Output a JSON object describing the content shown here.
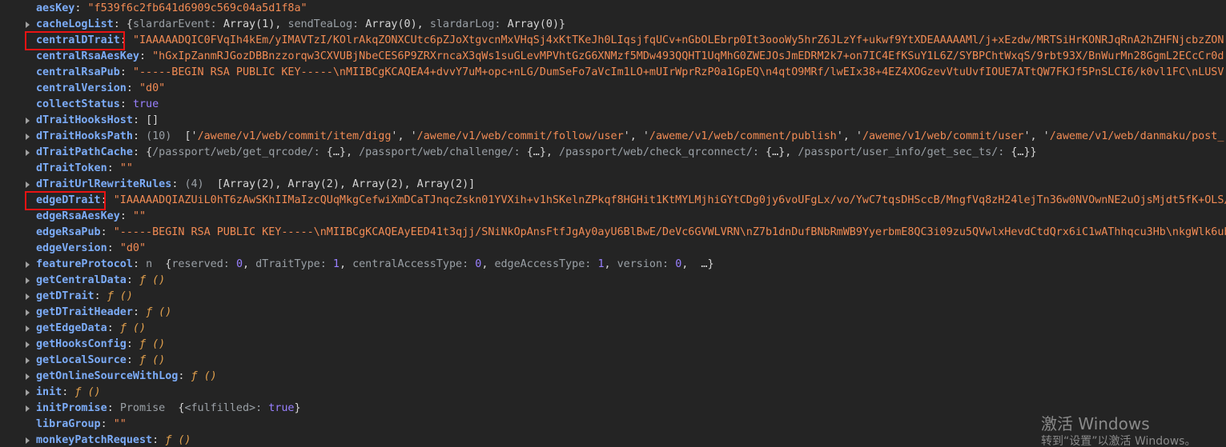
{
  "rows": [
    {
      "key": "aesKey",
      "expandable": false,
      "segments": [
        {
          "t": "str",
          "v": "\"f539f6c2fb641d6909c569c04a5d1f8a\""
        }
      ]
    },
    {
      "key": "cacheLogList",
      "expandable": true,
      "segments": [
        {
          "t": "plain",
          "v": "{"
        },
        {
          "t": "dim",
          "v": "slardarEvent: "
        },
        {
          "t": "plain",
          "v": "Array(1), "
        },
        {
          "t": "dim",
          "v": "sendTeaLog: "
        },
        {
          "t": "plain",
          "v": "Array(0), "
        },
        {
          "t": "dim",
          "v": "slardarLog: "
        },
        {
          "t": "plain",
          "v": "Array(0)}"
        }
      ]
    },
    {
      "key": "centralDTrait",
      "expandable": false,
      "highlighted": true,
      "segments": [
        {
          "t": "str",
          "v": "\"IAAAAADQIC0FVqIh4kEm/yIMAVTzI/KOlrAkqZONXCUtc6pZJoXtgvcnMxVHqSj4xKtTKeJh0LIqsjfqUCv+nGbOLEbrp0It3oooWy5hrZ6JLzYf+ukwf9YtXDEAAAAAMl/j+xEzdw/MRTSiHrKONRJqRnA2hZHFNjcbzZON"
        }
      ]
    },
    {
      "key": "centralRsaAesKey",
      "expandable": false,
      "segments": [
        {
          "t": "str",
          "v": "\"hGxIpZanmRJGozDBBnzzorqw3CXVUBjNbeCES6P9ZRXrncaX3qWs1suGLevMPVhtGzG6XNMzf5MDw493QQHT1UqMhG0ZWEJOsJmEDRM2k7+on7IC4EfKSuY1L6Z/SYBPChtWxqS/9rbt93X/BnWurMn28GgmL2ECcCr0d"
        }
      ]
    },
    {
      "key": "centralRsaPub",
      "expandable": false,
      "segments": [
        {
          "t": "str",
          "v": "\"-----BEGIN RSA PUBLIC KEY-----\\nMIIBCgKCAQEA4+dvvY7uM+opc+nLG/DumSeFo7aVcIm1LO+mUIrWprRzP0a1GpEQ\\n4qtO9MRf/lwEIx38+4EZ4XOGzevVtuUvfIOUE7ATtQW7FKJf5PnSLCI6/k0vl1FC\\nLUSV"
        }
      ]
    },
    {
      "key": "centralVersion",
      "expandable": false,
      "segments": [
        {
          "t": "str",
          "v": "\"d0\""
        }
      ]
    },
    {
      "key": "collectStatus",
      "expandable": false,
      "segments": [
        {
          "t": "bool",
          "v": "true"
        }
      ]
    },
    {
      "key": "dTraitHooksHost",
      "expandable": true,
      "segments": [
        {
          "t": "plain",
          "v": "[]"
        }
      ]
    },
    {
      "key": "dTraitHooksPath",
      "expandable": true,
      "segments": [
        {
          "t": "dim",
          "v": "(10)  "
        },
        {
          "t": "plain",
          "v": "['"
        },
        {
          "t": "str",
          "v": "/aweme/v1/web/commit/item/digg"
        },
        {
          "t": "plain",
          "v": "', '"
        },
        {
          "t": "str",
          "v": "/aweme/v1/web/commit/follow/user"
        },
        {
          "t": "plain",
          "v": "', '"
        },
        {
          "t": "str",
          "v": "/aweme/v1/web/comment/publish"
        },
        {
          "t": "plain",
          "v": "', '"
        },
        {
          "t": "str",
          "v": "/aweme/v1/web/commit/user"
        },
        {
          "t": "plain",
          "v": "', '"
        },
        {
          "t": "str",
          "v": "/aweme/v1/web/danmaku/post_"
        }
      ]
    },
    {
      "key": "dTraitPathCache",
      "expandable": true,
      "segments": [
        {
          "t": "plain",
          "v": "{"
        },
        {
          "t": "dim",
          "v": "/passport/web/get_qrcode/: "
        },
        {
          "t": "plain",
          "v": "{…}, "
        },
        {
          "t": "dim",
          "v": "/passport/web/challenge/: "
        },
        {
          "t": "plain",
          "v": "{…}, "
        },
        {
          "t": "dim",
          "v": "/passport/web/check_qrconnect/: "
        },
        {
          "t": "plain",
          "v": "{…}, "
        },
        {
          "t": "dim",
          "v": "/passport/user_info/get_sec_ts/: "
        },
        {
          "t": "plain",
          "v": "{…}}"
        }
      ]
    },
    {
      "key": "dTraitToken",
      "expandable": false,
      "segments": [
        {
          "t": "str",
          "v": "\"\""
        }
      ]
    },
    {
      "key": "dTraitUrlRewriteRules",
      "expandable": true,
      "segments": [
        {
          "t": "dim",
          "v": "(4)  "
        },
        {
          "t": "plain",
          "v": "[Array(2), Array(2), Array(2), Array(2)]"
        }
      ]
    },
    {
      "key": "edgeDTrait",
      "expandable": false,
      "highlighted": true,
      "segments": [
        {
          "t": "str",
          "v": "\"IAAAAADQIAZUiL0hT6zAwSKhIIMaIzcQUqMkgCefwiXmDCaTJnqcZskn01YVXih+v1hSKelnZPkqf8HGHit1KtMYLMjhiGYtCDg0jy6voUFgLx/vo/YwC7tqsDHSccB/MngfVq8zH24lejTn36w0NVOwnNE2uOjsMjdt5fK+OLS/"
        }
      ]
    },
    {
      "key": "edgeRsaAesKey",
      "expandable": false,
      "segments": [
        {
          "t": "str",
          "v": "\"\""
        }
      ]
    },
    {
      "key": "edgeRsaPub",
      "expandable": false,
      "segments": [
        {
          "t": "str",
          "v": "\"-----BEGIN RSA PUBLIC KEY-----\\nMIIBCgKCAQEAyEED41t3qjj/SNiNkOpAnsFtfJgAy0ayU6BlBwE/DeVc6GVWLVRN\\nZ7b1dnDufBNbRmWB9YyerbmE8QC3i09zu5QVwlxHevdCtdQrx6iC1wAThhqcu3Hb\\nkgWlk6ub"
        }
      ]
    },
    {
      "key": "edgeVersion",
      "expandable": false,
      "segments": [
        {
          "t": "str",
          "v": "\"d0\""
        }
      ]
    },
    {
      "key": "featureProtocol",
      "expandable": true,
      "segments": [
        {
          "t": "dim",
          "v": "n  "
        },
        {
          "t": "plain",
          "v": "{"
        },
        {
          "t": "dim",
          "v": "reserved: "
        },
        {
          "t": "num",
          "v": "0"
        },
        {
          "t": "plain",
          "v": ", "
        },
        {
          "t": "dim",
          "v": "dTraitType: "
        },
        {
          "t": "num",
          "v": "1"
        },
        {
          "t": "plain",
          "v": ", "
        },
        {
          "t": "dim",
          "v": "centralAccessType: "
        },
        {
          "t": "num",
          "v": "0"
        },
        {
          "t": "plain",
          "v": ", "
        },
        {
          "t": "dim",
          "v": "edgeAccessType: "
        },
        {
          "t": "num",
          "v": "1"
        },
        {
          "t": "plain",
          "v": ", "
        },
        {
          "t": "dim",
          "v": "version: "
        },
        {
          "t": "num",
          "v": "0"
        },
        {
          "t": "plain",
          "v": ",  …}"
        }
      ]
    },
    {
      "key": "getCentralData",
      "expandable": true,
      "segments": [
        {
          "t": "fn",
          "v": "ƒ ()"
        }
      ]
    },
    {
      "key": "getDTrait",
      "expandable": true,
      "segments": [
        {
          "t": "fn",
          "v": "ƒ ()"
        }
      ]
    },
    {
      "key": "getDTraitHeader",
      "expandable": true,
      "segments": [
        {
          "t": "fn",
          "v": "ƒ ()"
        }
      ]
    },
    {
      "key": "getEdgeData",
      "expandable": true,
      "segments": [
        {
          "t": "fn",
          "v": "ƒ ()"
        }
      ]
    },
    {
      "key": "getHooksConfig",
      "expandable": true,
      "segments": [
        {
          "t": "fn",
          "v": "ƒ ()"
        }
      ]
    },
    {
      "key": "getLocalSource",
      "expandable": true,
      "segments": [
        {
          "t": "fn",
          "v": "ƒ ()"
        }
      ]
    },
    {
      "key": "getOnlineSourceWithLog",
      "expandable": true,
      "segments": [
        {
          "t": "fn",
          "v": "ƒ ()"
        }
      ]
    },
    {
      "key": "init",
      "expandable": true,
      "segments": [
        {
          "t": "fn",
          "v": "ƒ ()"
        }
      ]
    },
    {
      "key": "initPromise",
      "expandable": true,
      "segments": [
        {
          "t": "dim",
          "v": "Promise  "
        },
        {
          "t": "plain",
          "v": "{"
        },
        {
          "t": "dim",
          "v": "<fulfilled>: "
        },
        {
          "t": "bool",
          "v": "true"
        },
        {
          "t": "plain",
          "v": "}"
        }
      ]
    },
    {
      "key": "libraGroup",
      "expandable": false,
      "segments": [
        {
          "t": "str",
          "v": "\"\""
        }
      ]
    },
    {
      "key": "monkeyPatchRequest",
      "expandable": true,
      "segments": [
        {
          "t": "fn",
          "v": "ƒ ()"
        }
      ]
    }
  ],
  "watermark": {
    "line1": "激活 Windows",
    "line2": "转到“设置”以激活 Windows。"
  },
  "colors": {
    "background": "#242424",
    "key": "#7cacf8",
    "string": "#f28b54",
    "number": "#9980ff",
    "highlight_border": "#e81313"
  }
}
